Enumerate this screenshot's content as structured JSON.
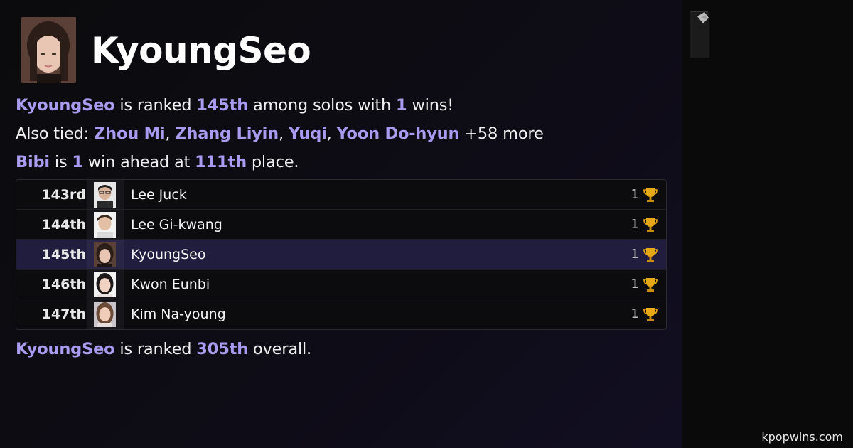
{
  "header": {
    "name": "KyoungSeo"
  },
  "summary": {
    "line1": {
      "name": "KyoungSeo",
      "t1": " is ranked ",
      "rank": "145th",
      "t2": " among solos with ",
      "wins": "1",
      "t3": " wins!"
    },
    "line2": {
      "prefix": "Also tied: ",
      "tied": [
        "Zhou Mi",
        "Zhang Liyin",
        "Yuqi",
        "Yoon Do-hyun"
      ],
      "sep": ", ",
      "more": " +58 more"
    },
    "line3": {
      "name": "Bibi",
      "t1": " is ",
      "wins": "1",
      "t2": " win ahead at ",
      "rank": "111th",
      "t3": " place."
    },
    "line4": {
      "name": "KyoungSeo",
      "t1": " is ranked ",
      "rank": "305th",
      "t2": " overall."
    }
  },
  "leaderboard": {
    "rows": [
      {
        "rank": "143rd",
        "name": "Lee Juck",
        "wins": "1",
        "active": false
      },
      {
        "rank": "144th",
        "name": "Lee Gi-kwang",
        "wins": "1",
        "active": false
      },
      {
        "rank": "145th",
        "name": "KyoungSeo",
        "wins": "1",
        "active": true
      },
      {
        "rank": "146th",
        "name": "Kwon Eunbi",
        "wins": "1",
        "active": false
      },
      {
        "rank": "147th",
        "name": "Kim Na-young",
        "wins": "1",
        "active": false
      }
    ]
  },
  "footer": {
    "site": "kpopwins.com"
  },
  "colors": {
    "accent": "#a99bf0",
    "active_row": "#211d3e",
    "trophy": "#e6a817"
  }
}
